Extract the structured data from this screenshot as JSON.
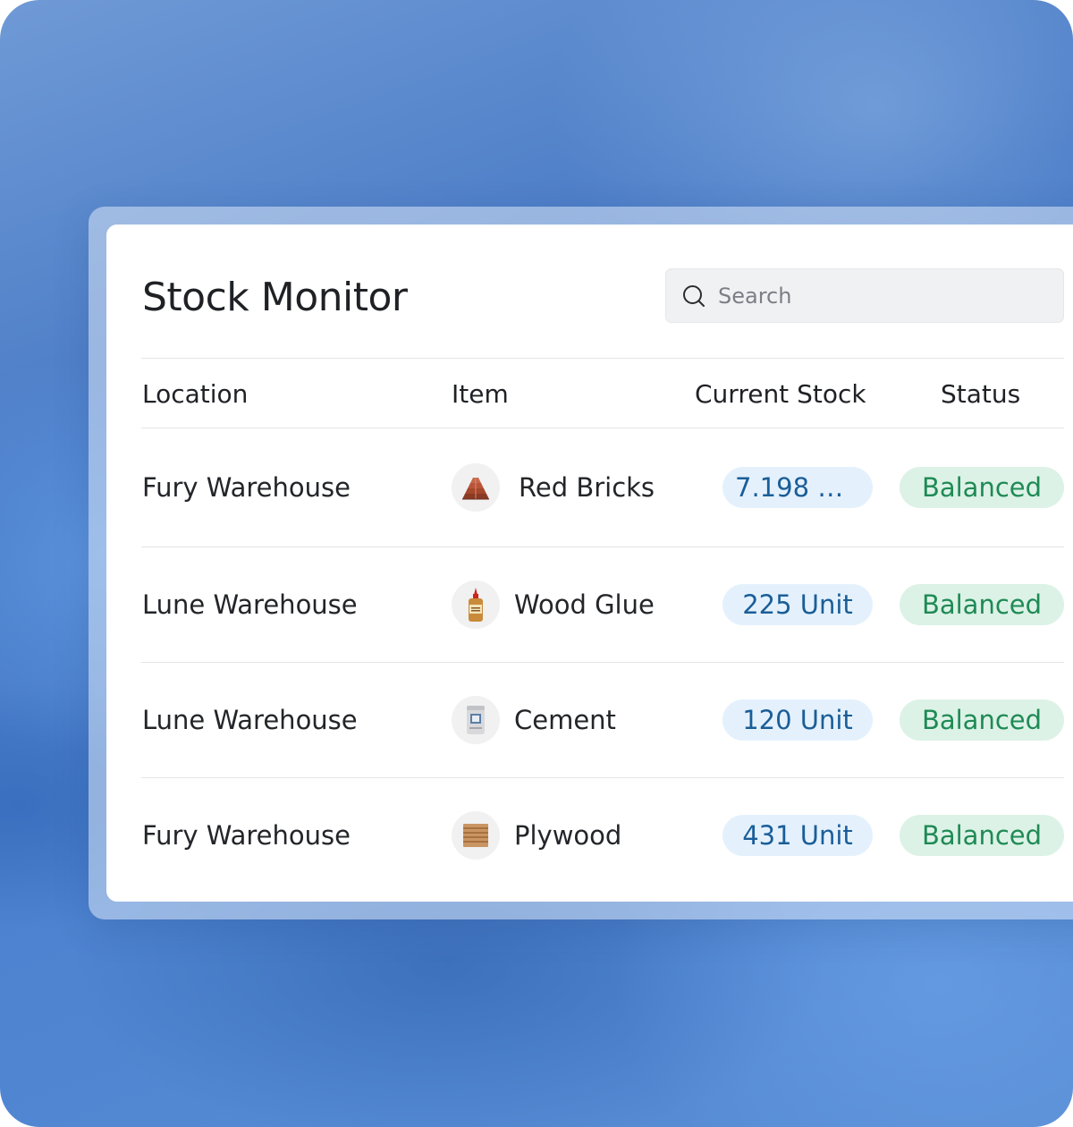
{
  "app": {
    "title": "Stock Monitor"
  },
  "search": {
    "placeholder": "Search",
    "icon": "search-icon"
  },
  "table": {
    "headers": {
      "location": "Location",
      "item": "Item",
      "current_stock": "Current Stock",
      "status": "Status"
    },
    "rows": [
      {
        "location": "Fury Warehouse",
        "item": "Red Bricks",
        "item_icon": "red-bricks-icon",
        "stock": "7.198 U...",
        "status": "Balanced"
      },
      {
        "location": "Lune Warehouse",
        "item": "Wood Glue",
        "item_icon": "wood-glue-icon",
        "stock": "225 Unit",
        "status": "Balanced"
      },
      {
        "location": "Lune Warehouse",
        "item": "Cement",
        "item_icon": "cement-icon",
        "stock": "120 Unit",
        "status": "Balanced"
      },
      {
        "location": "Fury Warehouse",
        "item": "Plywood",
        "item_icon": "plywood-icon",
        "stock": "431 Unit",
        "status": "Balanced"
      }
    ]
  },
  "colors": {
    "stock_pill_bg": "#e4f1fd",
    "stock_pill_text": "#1a5e98",
    "status_pill_bg": "#dcf2e6",
    "status_pill_text": "#1f8a55",
    "background": "#4577c4"
  }
}
